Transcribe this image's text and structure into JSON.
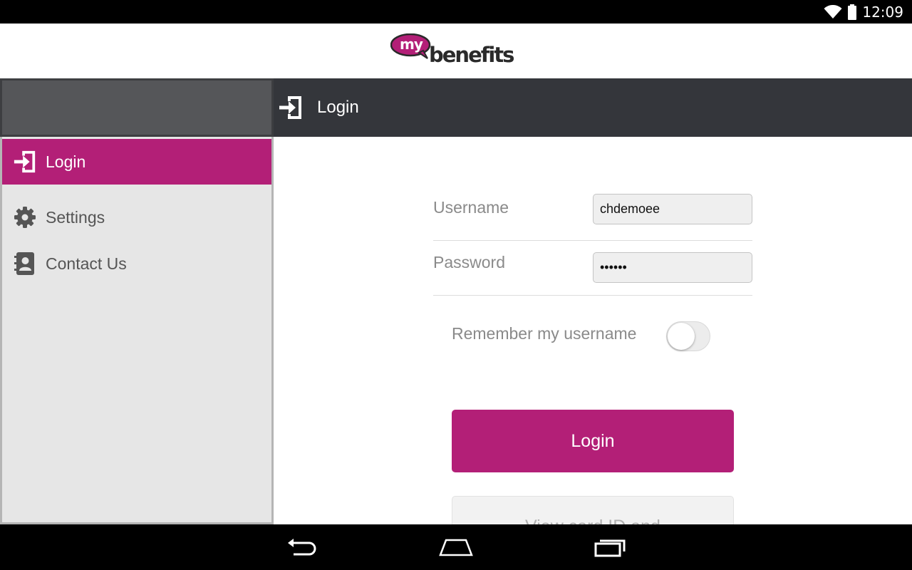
{
  "status_bar": {
    "time": "12:09",
    "icons": [
      "wifi-icon",
      "battery-icon"
    ]
  },
  "logo": {
    "my": "my",
    "benefits": "benefits",
    "trademark": "®",
    "brand_color": "#b31f77"
  },
  "title_bar": {
    "icon": "login-icon",
    "title": "Login"
  },
  "sidebar": {
    "items": [
      {
        "label": "Login",
        "icon": "login-icon",
        "active": true
      },
      {
        "label": "Settings",
        "icon": "gear-icon",
        "active": false
      },
      {
        "label": "Contact Us",
        "icon": "contact-book-icon",
        "active": false
      }
    ]
  },
  "form": {
    "username_label": "Username",
    "username_value": "chdemoee",
    "password_label": "Password",
    "password_value": "••••••",
    "remember_label": "Remember my username",
    "remember_on": false,
    "login_button": "Login",
    "secondary_button_partial": "View card ID and"
  },
  "nav_bar": {
    "icons": [
      "back-icon",
      "home-icon",
      "recent-apps-icon"
    ]
  },
  "colors": {
    "accent": "#b31f77",
    "title_bar": "#34363b",
    "sidebar_header": "#555659",
    "sidebar_bg": "#e6e6e6"
  }
}
